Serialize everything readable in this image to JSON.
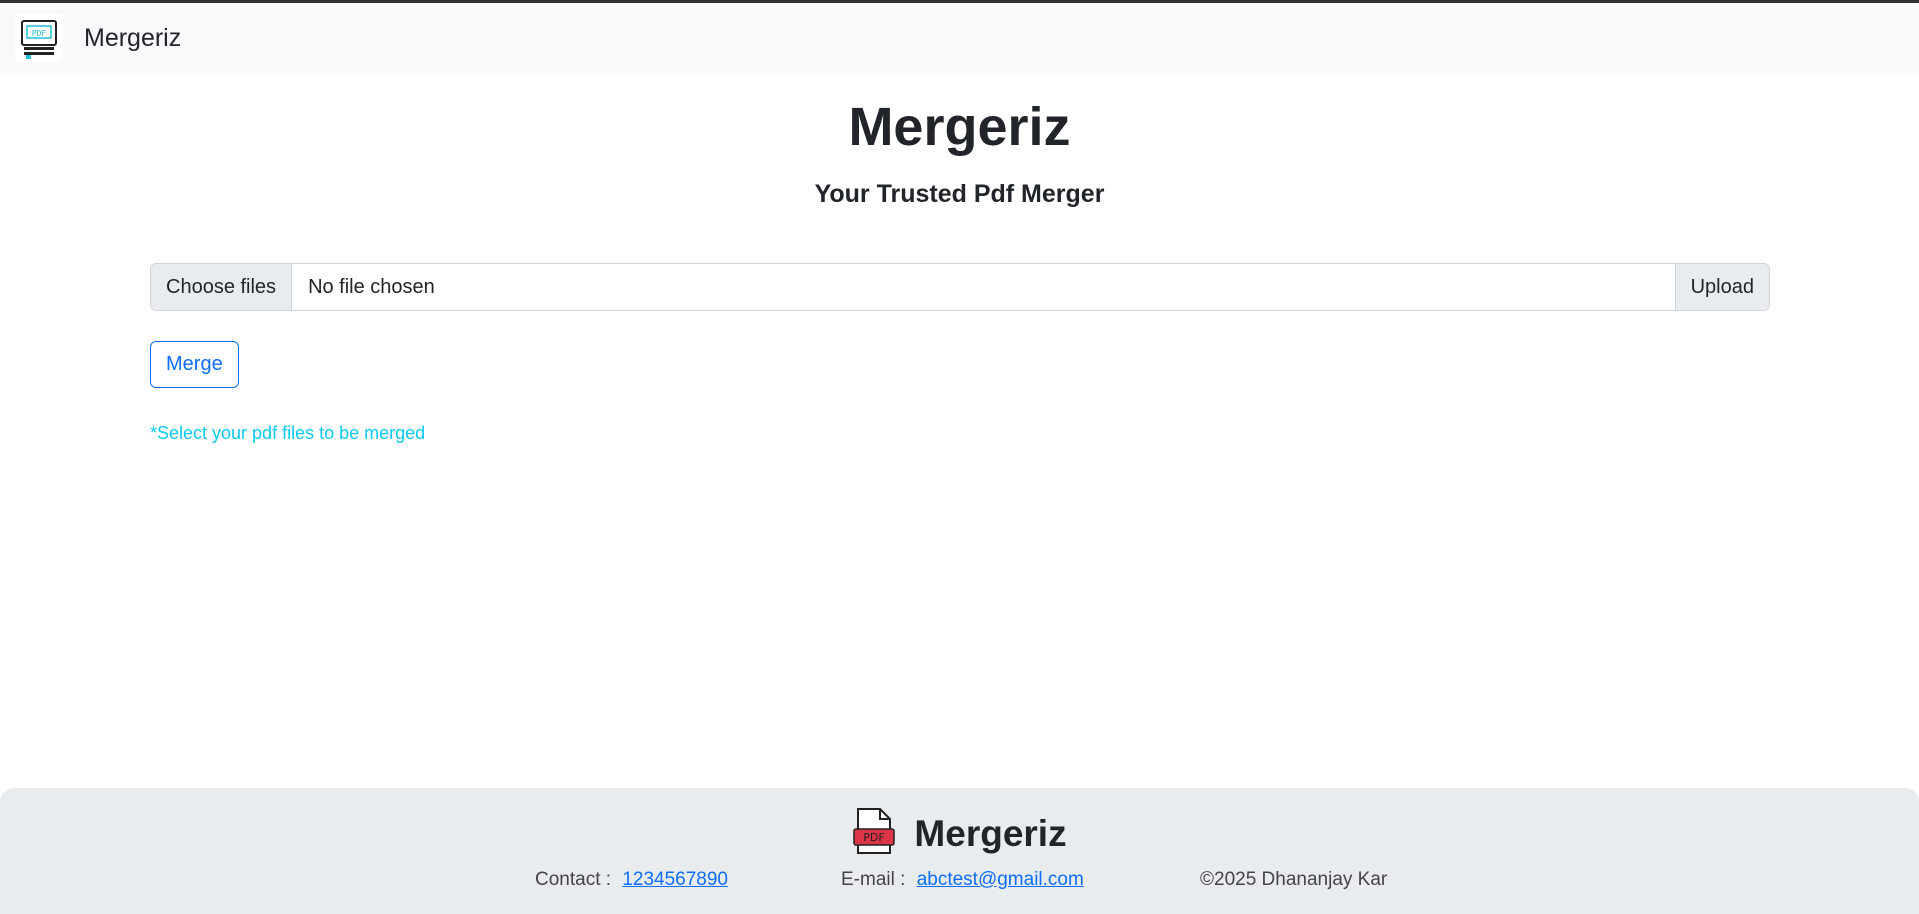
{
  "navbar": {
    "brand": "Mergeriz",
    "logo_icon": "pdf-monitor-icon",
    "logo_text": "PDF"
  },
  "hero": {
    "title": "Mergeriz",
    "subtitle": "Your Trusted Pdf Merger"
  },
  "upload": {
    "choose_label": "Choose files",
    "file_status": "No file chosen",
    "upload_label": "Upload"
  },
  "merge": {
    "label": "Merge"
  },
  "hint": {
    "text": "*Select your pdf files to be merged"
  },
  "footer": {
    "brand": "Mergeriz",
    "logo_icon": "pdf-file-icon",
    "logo_text": "PDF",
    "contact_label": "Contact :",
    "contact_value": "1234567890",
    "email_label": "E-mail :",
    "email_value": "abctest@gmail.com",
    "copyright": "©2025 Dhananjay Kar"
  },
  "colors": {
    "primary": "#0d6efd",
    "info": "#0dcaf0",
    "navbar_bg": "#f8f9fa",
    "footer_bg": "#e9ecef",
    "pdf_red": "#dc3545"
  }
}
